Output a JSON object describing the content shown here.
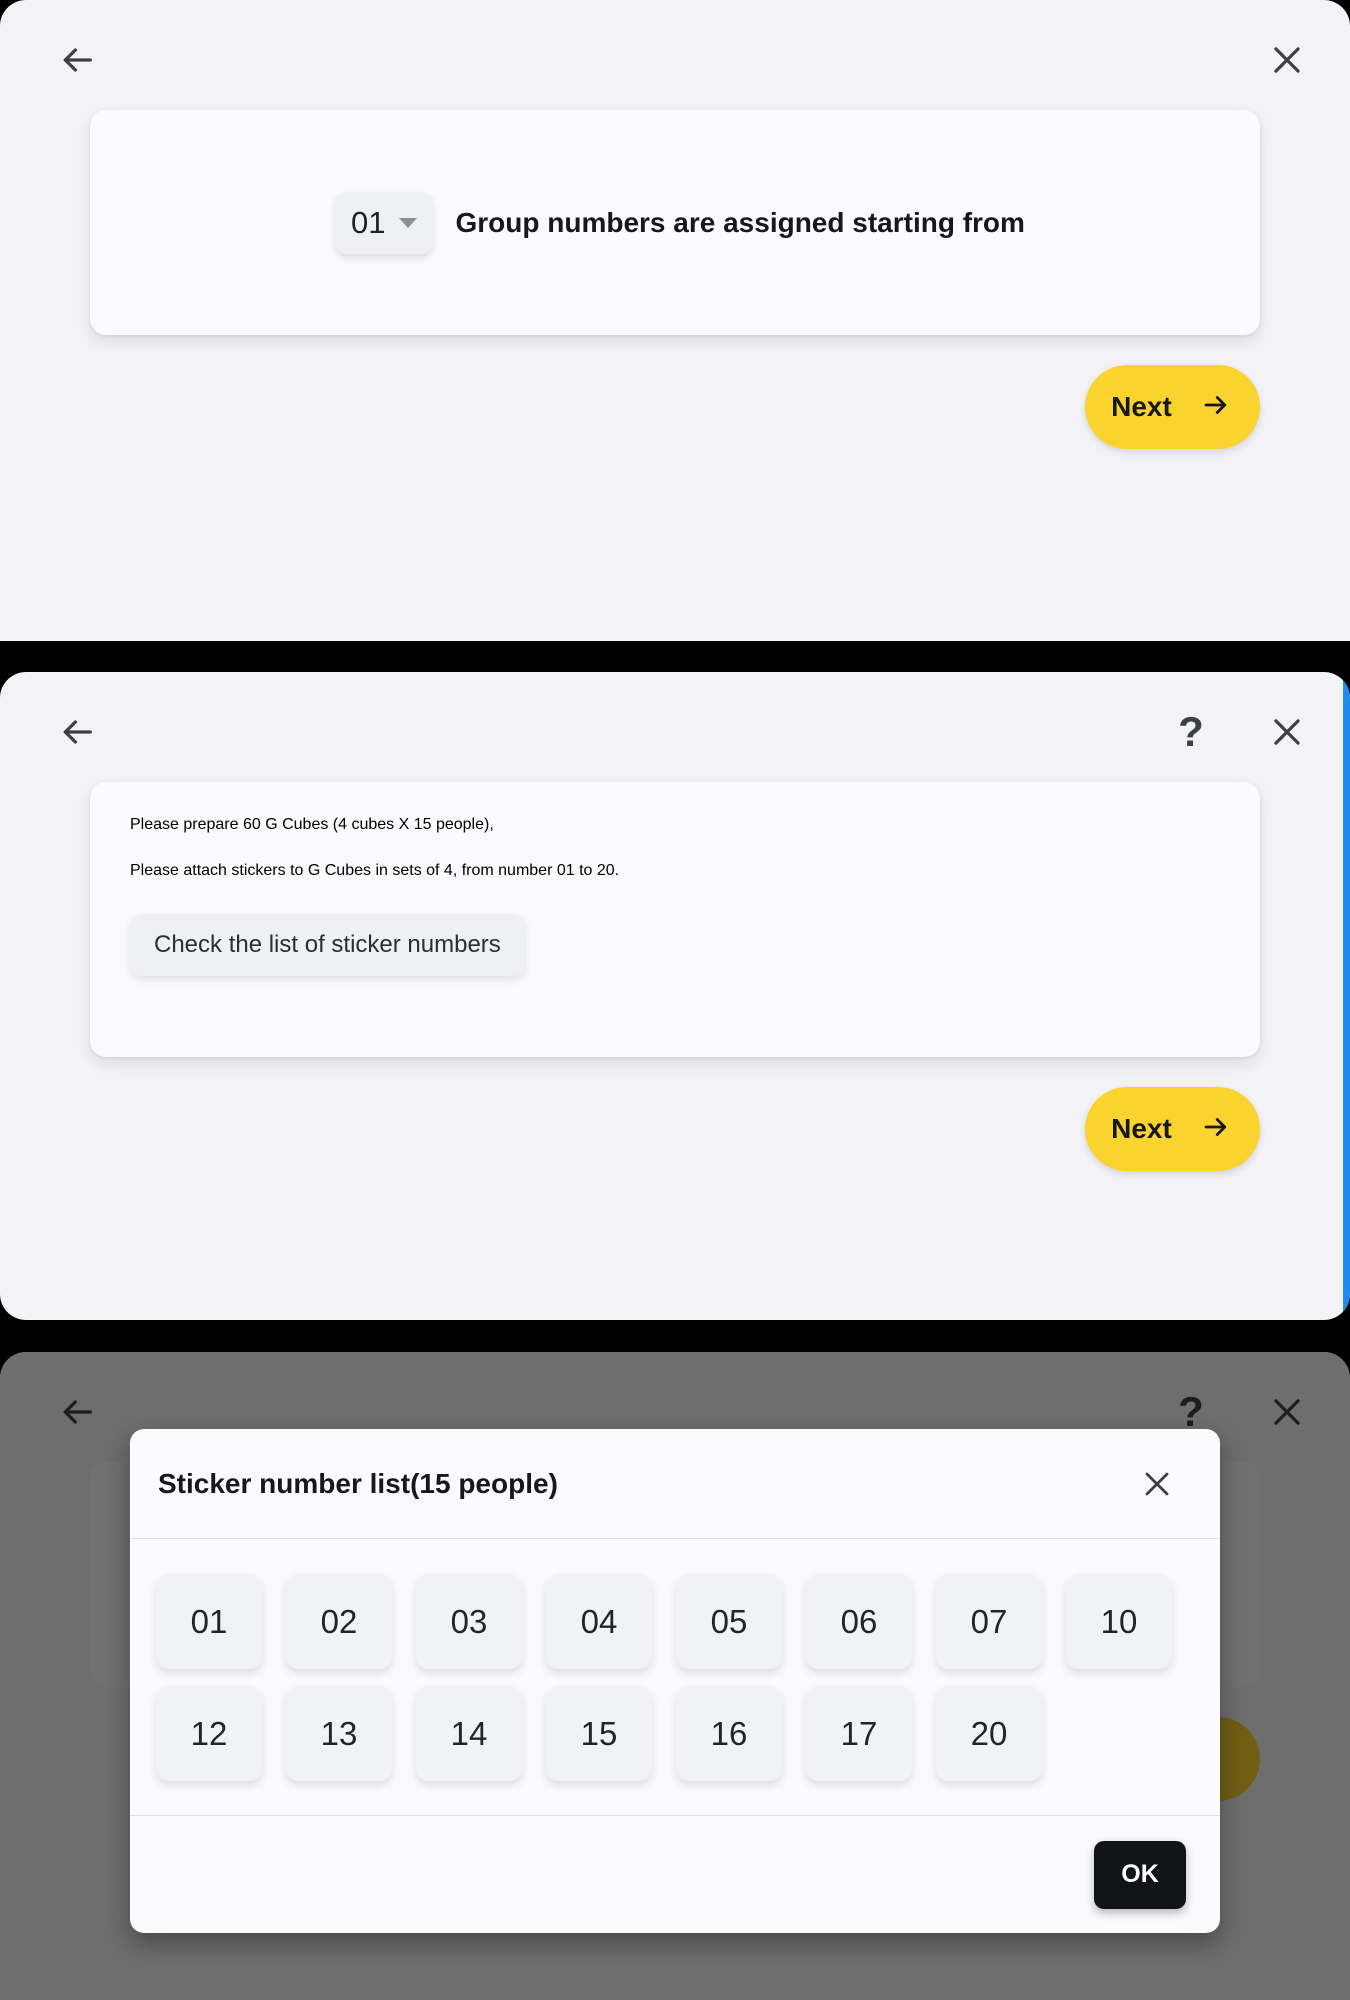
{
  "colors": {
    "accent_yellow": "#fad32e",
    "panel_bg": "#f3f3f7",
    "card_bg": "#fbfbfd",
    "blue_edge": "#1b8cf5",
    "ok_button": "#101418",
    "chip_bg": "#eef0f3"
  },
  "screen1": {
    "back_icon": "arrow-left-icon",
    "close_icon": "close-icon",
    "group_select": {
      "value": "01",
      "caret_icon": "chevron-down-icon"
    },
    "label": "Group numbers are assigned starting from",
    "next_button": {
      "label": "Next",
      "icon": "arrow-right-icon"
    }
  },
  "screen2": {
    "back_icon": "arrow-left-icon",
    "help_icon": "question-mark-icon",
    "help_label": "?",
    "close_icon": "close-icon",
    "instructions": [
      "Please prepare 60 G Cubes (4 cubes X 15 people),",
      "Please attach stickers to G Cubes in sets of 4, from number 01 to 20."
    ],
    "check_list_button": "Check the list of sticker numbers",
    "next_button": {
      "label": "Next",
      "icon": "arrow-right-icon"
    }
  },
  "screen3": {
    "back_icon": "arrow-left-icon",
    "help_label": "?",
    "close_icon": "close-icon",
    "dialog": {
      "title": "Sticker number list(15 people)",
      "close_icon": "close-icon",
      "rows": [
        [
          "01",
          "02",
          "03",
          "04",
          "05",
          "06",
          "07",
          "10"
        ],
        [
          "12",
          "13",
          "14",
          "15",
          "16",
          "17",
          "20"
        ]
      ],
      "ok_button": "OK"
    }
  }
}
